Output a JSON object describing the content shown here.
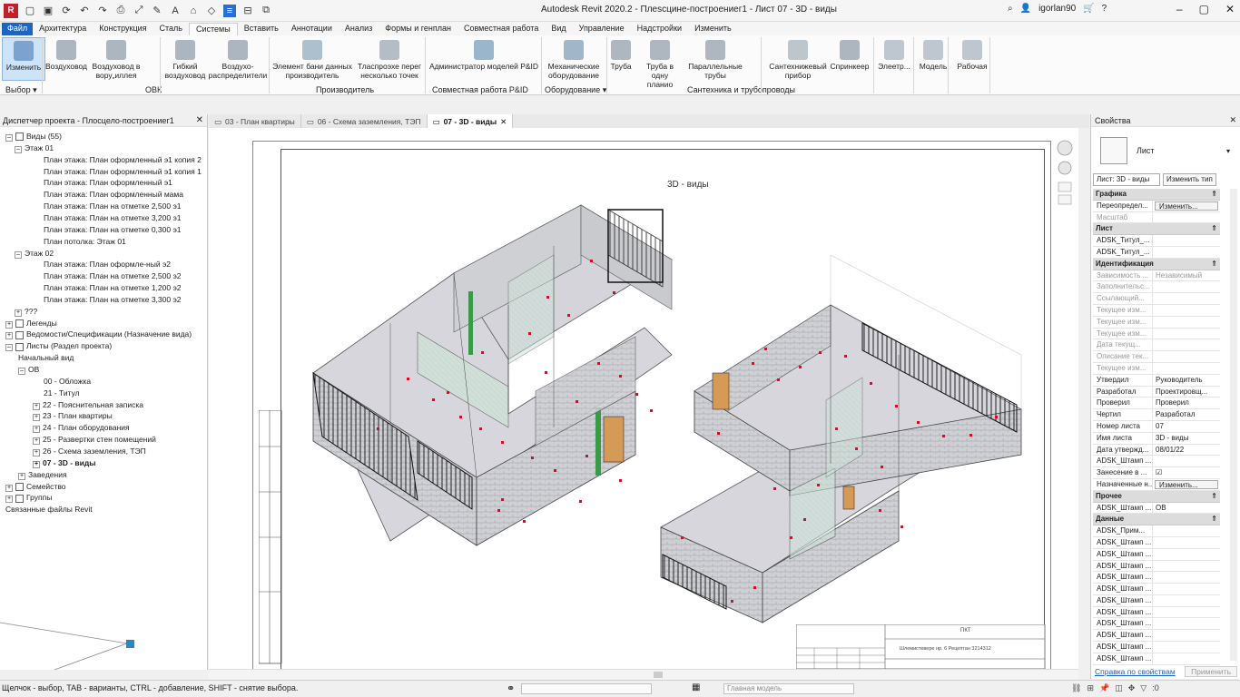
{
  "titlebar": {
    "app_title": "Autodesk Revit 2020.2 - Плеsсцине-построениег1 - Лист 07 - 3D - виды",
    "user": "igorlan90",
    "quick_access_icons": [
      "revit-logo",
      "open-icon",
      "save-icon",
      "sync-icon",
      "undo-icon",
      "redo-icon",
      "print-icon",
      "measure-icon",
      "annotate-icon",
      "text-icon",
      "3d-view-icon",
      "section-icon",
      "thin-lines-icon",
      "close-hidden-icon",
      "switch-windows-icon"
    ]
  },
  "ribbon_tabs": [
    "Файл",
    "Архитектура",
    "Конструкция",
    "Сталь",
    "Системы",
    "Вставить",
    "Аннотации",
    "Анализ",
    "Формы и генплан",
    "Совместная работа",
    "Вид",
    "Управление",
    "Надстройки",
    "Изменить"
  ],
  "active_ribbon_tab": "Системы",
  "ribbon": {
    "buttons": [
      {
        "label": "Изменить"
      },
      {
        "label": "Воздуховод"
      },
      {
        "label": "Воздуховод в вору„иллея"
      },
      {
        "label": "Гибкий воздуховод"
      },
      {
        "label": "Воздухо-распределители"
      },
      {
        "label": "Элемент бани данных производитель"
      },
      {
        "label": "Тласпроэхе перег несколько точек"
      },
      {
        "label": "Администратор моделей P&ID"
      },
      {
        "label": "Механические оборудование"
      },
      {
        "label": "Труба"
      },
      {
        "label": "Труба в одну планио"
      },
      {
        "label": "Параллельные трубы"
      },
      {
        "label": "Сантехнижевый прибор"
      },
      {
        "label": "Спринкеер"
      },
      {
        "label": "Элеетр..."
      },
      {
        "label": "Модель"
      },
      {
        "label": "Рабочая"
      }
    ],
    "groups": [
      "Выбор ▾",
      "ОВК",
      "Производитель",
      "Совместная работа P&ID",
      "Оборудование ▾",
      "Сантехника и трубопроводы"
    ]
  },
  "project_browser": {
    "title": "Диспетчер проекта - Плосцело-построениег1",
    "rows": [
      "Виды (55)",
      "Этаж 01",
      "План этажа: План оформленный э1 копия 2",
      "План этажа: План оформленный э1 копия 1",
      "План этажа: План оформленный э1",
      "План этажа: План оформленный мама",
      "План этажа: План на отметке 2,500 э1",
      "План этажа: План на отметке 3,200 э1",
      "План этажа: План на отметке 0,300 э1",
      "План потолка: Этаж 01",
      "Этаж 02",
      "План этажа: План оформле-ный э2",
      "План этажа: План на отметке 2,500 э2",
      "План этажа: План на отметке 1,200 э2",
      "План этажа: План на отметке 3,300 э2",
      "???",
      "Легенды",
      "Ведомости/Спецификации (Назначение вида)",
      "Листы (Раздел проекта)",
      "Начальный вид",
      "ОВ",
      "00 - Обложка",
      "21 - Титул",
      "22 - Пояснительная записка",
      "23 - План квартиры",
      "24 - План оборудования",
      "25 - Развертки стен помещений",
      "26 - Схема заземления, ТЭП",
      "07 - 3D - виды",
      "Заведения",
      "Семейство",
      "Группы",
      "Связанные файлы Revit"
    ]
  },
  "view_tabs": [
    {
      "label": "03 - План квартиры"
    },
    {
      "label": "06 - Схема заземления, ТЭП"
    },
    {
      "label": "07 - 3D - виды"
    }
  ],
  "sheet": {
    "title": "3D - виды",
    "titleblock_line1": "ПКТ",
    "titleblock_line2": "Шлемистевере нр. 6 Рецептан 3214312"
  },
  "properties": {
    "title": "Свойства",
    "type_name": "Лист",
    "instance_selector": "Лист: 3D - виды",
    "edit_type": "Изменить тип",
    "sections": [
      {
        "name": "Графика",
        "rows": [
          {
            "k": "Переопредел...",
            "v": "Изменить...",
            "btn": true
          },
          {
            "k": "Масштаб",
            "v": "",
            "dim": true
          }
        ]
      },
      {
        "name": "Лист",
        "rows": [
          {
            "k": "ADSK_Титул_...",
            "v": ""
          },
          {
            "k": "ADSK_Титул_...",
            "v": ""
          }
        ]
      },
      {
        "name": "Идентификация",
        "rows": [
          {
            "k": "Зависимость ...",
            "v": "Независимый",
            "dim": true
          },
          {
            "k": "Заполнительс...",
            "v": "",
            "dim": true
          },
          {
            "k": "Ссылающий...",
            "v": "",
            "dim": true
          },
          {
            "k": "Текущее изм...",
            "v": "",
            "dim": true
          },
          {
            "k": "Текущее изм...",
            "v": "",
            "dim": true
          },
          {
            "k": "Текущее изм...",
            "v": "",
            "dim": true
          },
          {
            "k": "Дата текущ...",
            "v": "",
            "dim": true
          },
          {
            "k": "Описание тек...",
            "v": "",
            "dim": true
          },
          {
            "k": "Текущее изм...",
            "v": "",
            "dim": true
          },
          {
            "k": "Утвердил",
            "v": "Руководитель"
          },
          {
            "k": "Разработал",
            "v": "Проектировщ..."
          },
          {
            "k": "Проверил",
            "v": "Проверил"
          },
          {
            "k": "Чертил",
            "v": "Разработал"
          },
          {
            "k": "Номер листа",
            "v": "07"
          },
          {
            "k": "Имя листа",
            "v": "3D - виды"
          },
          {
            "k": "Дата утвержд...",
            "v": "08/01/22"
          },
          {
            "k": "ADSK_Штамп ...",
            "v": ""
          },
          {
            "k": "Занесение в ...",
            "v": "☑"
          },
          {
            "k": "Назначенные н...",
            "v": "Изменить...",
            "btn": true
          }
        ]
      },
      {
        "name": "Прочее",
        "rows": [
          {
            "k": "ADSK_Штамп ...",
            "v": "ОВ"
          }
        ]
      },
      {
        "name": "Данные",
        "rows": [
          {
            "k": "ADSK_Прим...",
            "v": ""
          },
          {
            "k": "ADSK_Штамп ...",
            "v": ""
          },
          {
            "k": "ADSK_Штамп ...",
            "v": ""
          },
          {
            "k": "ADSK_Штамп ...",
            "v": ""
          },
          {
            "k": "ADSK_Штамп ...",
            "v": ""
          },
          {
            "k": "ADSK_Штамп ...",
            "v": ""
          },
          {
            "k": "ADSK_Штамп ...",
            "v": ""
          },
          {
            "k": "ADSK_Штамп ...",
            "v": ""
          },
          {
            "k": "ADSK_Штамп ...",
            "v": ""
          },
          {
            "k": "ADSK_Штамп ...",
            "v": ""
          },
          {
            "k": "ADSK_Штамп ...",
            "v": ""
          },
          {
            "k": "ADSK_Штамп ...",
            "v": ""
          }
        ]
      }
    ],
    "help_link": "Справка по свойствам",
    "apply": "Применить"
  },
  "statusbar": {
    "text": "Щелчок - выбор, TAB - варианты, CTRL - добавление, SHIFT - снятие выбора.",
    "model_box": "Главная модель",
    "filter_count": ":0"
  },
  "colors": {
    "accent": "#1c65c2",
    "selection": "#cde3f7",
    "wall": "#c8c8cc",
    "floor": "#d9d9de",
    "red_marks": "#d0102a"
  }
}
